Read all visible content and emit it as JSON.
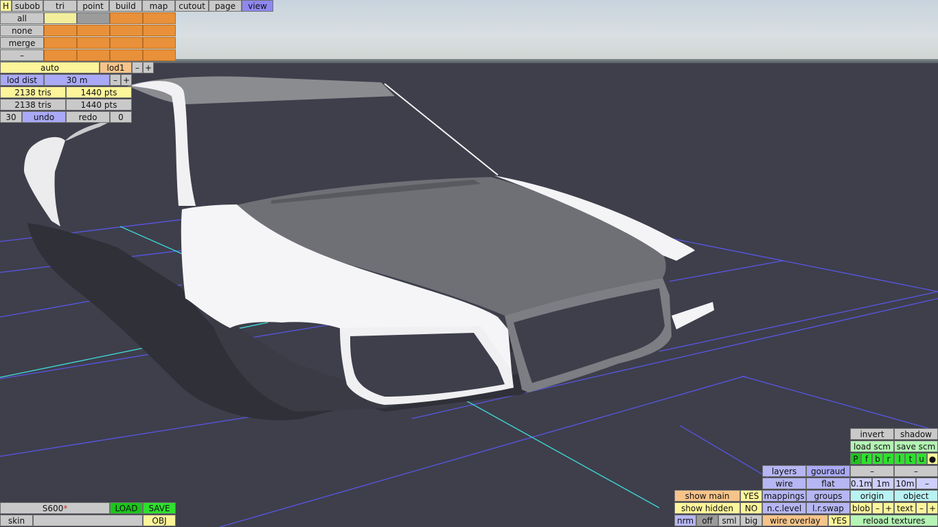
{
  "colors": {
    "accent_blue": "#a9a9f7",
    "accent_yellow": "#fdf59a",
    "accent_orange": "#e8913a",
    "accent_green": "#2fe02f",
    "grid_blue": "#5a55e6",
    "grid_cyan": "#3fd4d4",
    "ground": "#3e3f4b"
  },
  "menu": {
    "h": "H",
    "subob": "subob",
    "tri": "tri",
    "point": "point",
    "build": "build",
    "map": "map",
    "cutout": "cutout",
    "page": "page",
    "view": "view"
  },
  "select": {
    "all": "all",
    "none": "none",
    "merge": "merge",
    "minus": "–"
  },
  "lod": {
    "auto": "auto",
    "lod1": "lod1",
    "minus": "–",
    "plus": "+",
    "dist_label": "lod dist",
    "dist_value": "30 m"
  },
  "stats": [
    {
      "tris": "2138 tris",
      "pts": "1440 pts"
    },
    {
      "tris": "2138 tris",
      "pts": "1440 pts"
    }
  ],
  "history": {
    "count": "30",
    "undo": "undo",
    "redo": "redo",
    "redo_count": "0"
  },
  "file": {
    "name": "S600",
    "modified": "*",
    "load": "LOAD",
    "save": "SAVE",
    "skin": "skin",
    "obj": "OBJ"
  },
  "right": {
    "invert": "invert",
    "shadow": "shadow",
    "load_scm": "load scm",
    "save_scm": "save scm",
    "views": [
      "P",
      "f",
      "b",
      "r",
      "l",
      "t",
      "u",
      "●"
    ],
    "layers": "layers",
    "gouraud": "gouraud",
    "wire": "wire",
    "flat": "flat",
    "mappings": "mappings",
    "groups": "groups",
    "nclevel": "n.c.level",
    "lrswap": "l.r.swap",
    "wire_overlay": "wire overlay",
    "wire_overlay_val": "YES",
    "dash1": "–",
    "dash2": "–",
    "grid_01": "0.1m",
    "grid_1": "1m",
    "grid_10": "10m",
    "grid_minus": "–",
    "origin": "origin",
    "object": "object",
    "blob": "blob",
    "blob_minus": "–",
    "blob_plus": "+",
    "text": "text",
    "text_minus": "–",
    "text_plus": "+",
    "reload": "reload textures"
  },
  "show": {
    "main": "show main",
    "main_val": "YES",
    "hidden": "show hidden",
    "hidden_val": "NO"
  },
  "normals": {
    "nrm": "nrm",
    "off": "off",
    "sml": "sml",
    "big": "big"
  }
}
